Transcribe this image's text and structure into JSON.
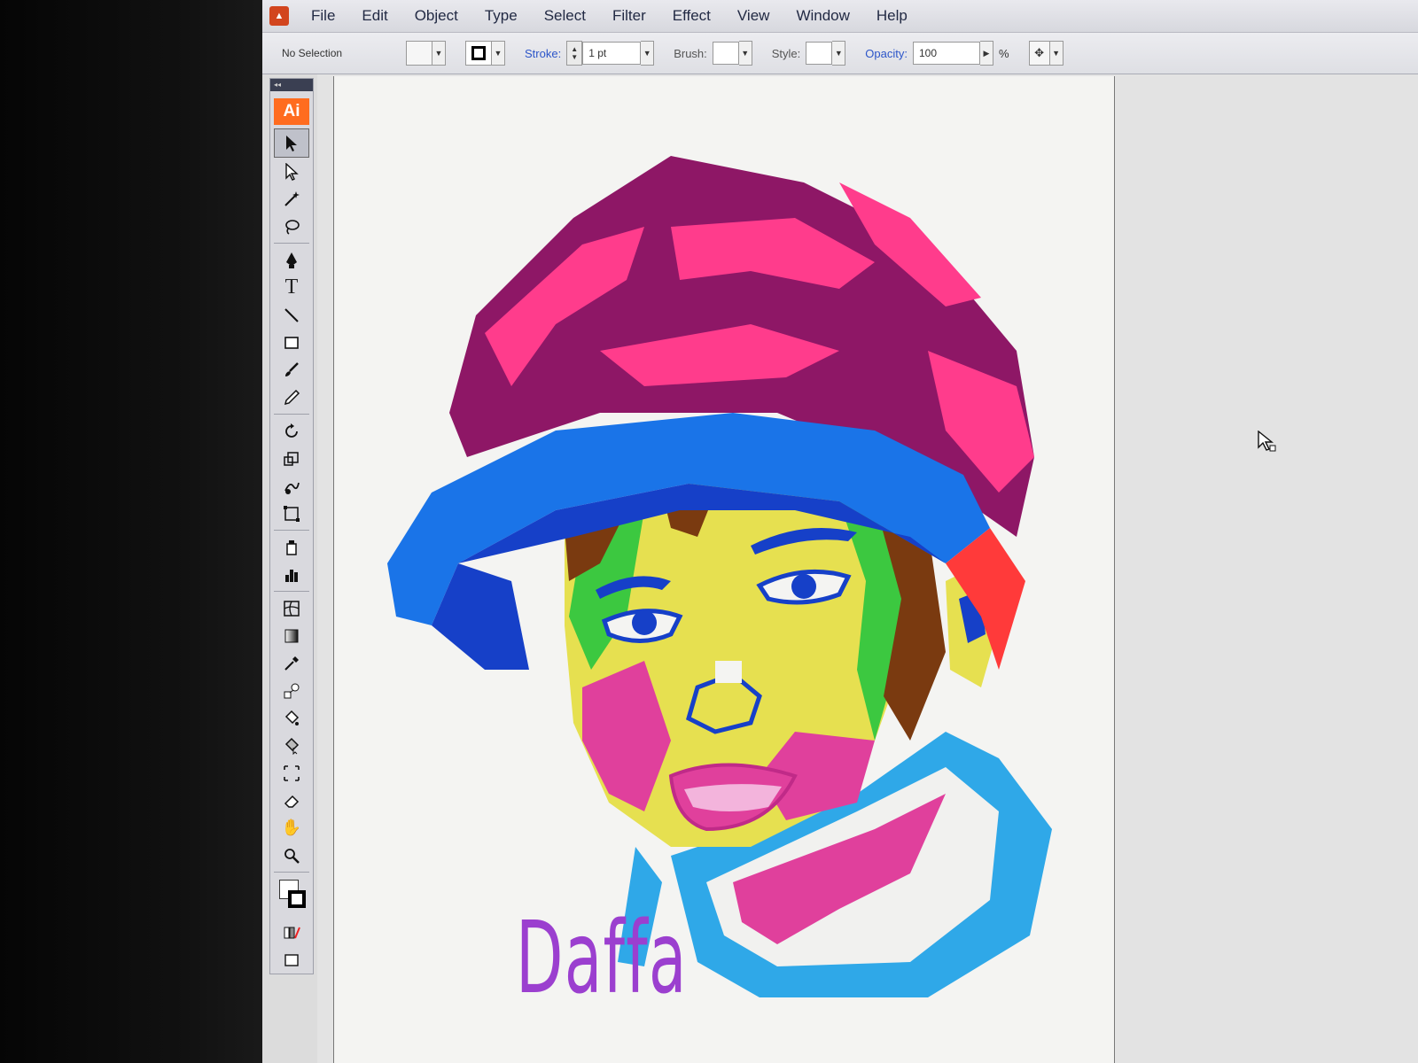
{
  "menubar": {
    "items": [
      "File",
      "Edit",
      "Object",
      "Type",
      "Select",
      "Filter",
      "Effect",
      "View",
      "Window",
      "Help"
    ]
  },
  "control_bar": {
    "selection_status": "No Selection",
    "stroke_label": "Stroke:",
    "stroke_weight": "1 pt",
    "brush_label": "Brush:",
    "style_label": "Style:",
    "opacity_label": "Opacity:",
    "opacity_value": "100",
    "opacity_unit": "%"
  },
  "tools_panel": {
    "logo": "Ai",
    "logo_color": "#ff6c1f",
    "tools": [
      "selection-tool",
      "direct-selection-tool",
      "magic-wand-tool",
      "lasso-tool",
      "pen-tool",
      "type-tool",
      "line-segment-tool",
      "rectangle-tool",
      "paintbrush-tool",
      "pencil-tool",
      "rotate-tool",
      "scale-tool",
      "warp-tool",
      "free-transform-tool",
      "symbol-sprayer-tool",
      "column-graph-tool",
      "mesh-tool",
      "gradient-tool",
      "eyedropper-tool",
      "blend-tool",
      "live-paint-bucket-tool",
      "live-paint-selection-tool",
      "slice-tool",
      "eraser-tool",
      "hand-tool",
      "zoom-tool"
    ]
  },
  "artwork": {
    "caption": "Daffa",
    "caption_color": "#9b3fcf",
    "palette": [
      "#8e1766",
      "#ff3c8c",
      "#1a74e8",
      "#1640c8",
      "#e6e050",
      "#3cc840",
      "#e0409c",
      "#7a3a10",
      "#2fa8e8"
    ]
  }
}
